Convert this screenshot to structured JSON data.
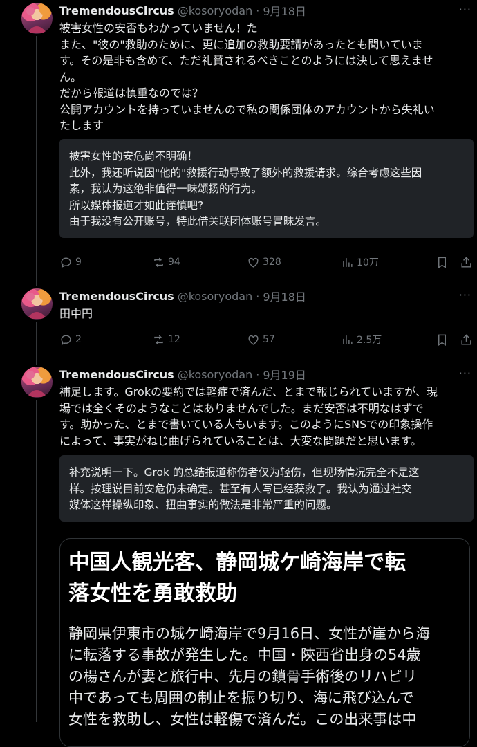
{
  "tweets": [
    {
      "name": "TremendousCircus",
      "handle": "@kosoryodan",
      "date": "9月18日",
      "text": "被害女性の安否もわかっていません！た\nまた、\"彼の\"救助のために、更に追加の救助要請があったとも聞いていま\nす。その是非も含めて、ただ礼賛されるべきことのようには決して思えませ\nん。\nだから報道は慎重なのでは？\n公開アカウントを持っていませんので私の関係団体のアカウントから失礼い\nたします",
      "quote": "被害女性的安危尚不明确！\n此外，我还听说因\"他的\"救援行动导致了额外的救援请求。综合考虑这些因\n素，我认为这绝非值得一味颂扬的行为。\n所以媒体报道才如此谨慎吧?\n由于我没有公开账号，特此借关联团体账号冒昧发言。",
      "replies": "9",
      "reposts": "94",
      "likes": "328",
      "views": "10万"
    },
    {
      "name": "TremendousCircus",
      "handle": "@kosoryodan",
      "date": "9月18日",
      "text": "田中円",
      "replies": "2",
      "reposts": "12",
      "likes": "57",
      "views": "2.5万"
    },
    {
      "name": "TremendousCircus",
      "handle": "@kosoryodan",
      "date": "9月19日",
      "text": "補足します。Grokの要約では軽症で済んだ、とまで報じられていますが、現\n場では全くそのようなことはありませんでした。まだ安否は不明なはずで\nす。助かった、とまで書いている人もいます。このようにSNSでの印象操作\nによって、事実がねじ曲げられていることは、大変な問題だと思います。",
      "quote": "补充说明一下。Grok 的总结报道称伤者仅为轻伤，但现场情况完全不是这\n样。按理说目前安危仍未确定。甚至有人写已经获救了。我认为通过社交\n媒体这样操纵印象、扭曲事实的做法是非常严重的问题。",
      "card_title": "中国人観光客、静岡城ケ崎海岸で転\n落女性を勇敢救助",
      "card_body": "静岡県伊東市の城ケ崎海岸で9月16日、女性が崖から海\nに転落する事故が発生した。中国・陝西省出身の54歳\nの楊さんが妻と旅行中、先月の鎖骨手術後のリハビリ\n中であっても周囲の制止を振り切り、海に飛び込んで\n女性を救助し、女性は軽傷で済んだ。この出来事は中"
    }
  ],
  "separator": "·",
  "more_glyph": "···"
}
